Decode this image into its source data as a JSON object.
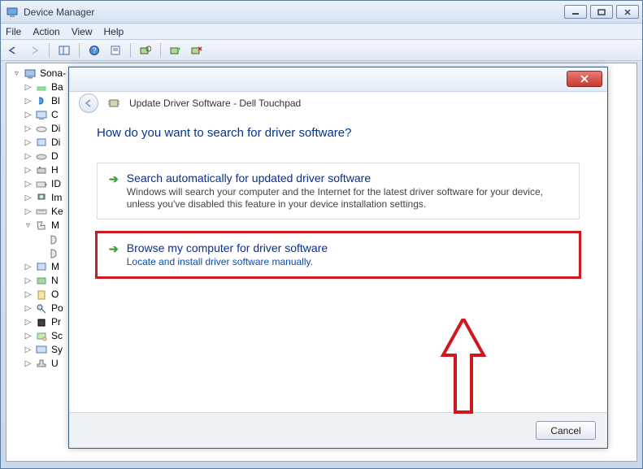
{
  "dm": {
    "title": "Device Manager",
    "menu": {
      "file": "File",
      "action": "Action",
      "view": "View",
      "help": "Help"
    },
    "root": "Sona-",
    "items": [
      {
        "label": "Ba",
        "toggle": "▷"
      },
      {
        "label": "Bl",
        "toggle": "▷"
      },
      {
        "label": "C",
        "toggle": "▷"
      },
      {
        "label": "Di",
        "toggle": "▷"
      },
      {
        "label": "Di",
        "toggle": "▷"
      },
      {
        "label": "D",
        "toggle": "▷"
      },
      {
        "label": "H",
        "toggle": "▷"
      },
      {
        "label": "ID",
        "toggle": "▷"
      },
      {
        "label": "Im",
        "toggle": "▷"
      },
      {
        "label": "Ke",
        "toggle": "▷"
      },
      {
        "label": "M",
        "toggle": "▿"
      },
      {
        "label": "M",
        "toggle": "▷"
      },
      {
        "label": "N",
        "toggle": "▷"
      },
      {
        "label": "O",
        "toggle": "▷"
      },
      {
        "label": "Po",
        "toggle": "▷"
      },
      {
        "label": "Pr",
        "toggle": "▷"
      },
      {
        "label": "Sc",
        "toggle": "▷"
      },
      {
        "label": "Sy",
        "toggle": "▷"
      },
      {
        "label": "U",
        "toggle": "▷"
      }
    ]
  },
  "dlg": {
    "header": "Update Driver Software - Dell Touchpad",
    "question": "How do you want to search for driver software?",
    "opt1_title": "Search automatically for updated driver software",
    "opt1_sub": "Windows will search your computer and the Internet for the latest driver software for your device, unless you've disabled this feature in your device installation settings.",
    "opt2_title": "Browse my computer for driver software",
    "opt2_sub": "Locate and install driver software manually.",
    "cancel": "Cancel"
  }
}
